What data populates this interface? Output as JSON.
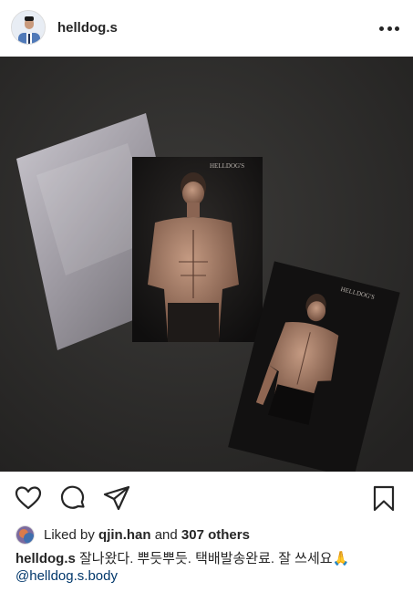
{
  "post": {
    "username": "helldog.s",
    "brand_label_1": "HELLDOG'S",
    "brand_label_2": "HELLDOG'S"
  },
  "likes": {
    "prefix": "Liked by ",
    "user": "qjin.han",
    "connector": " and ",
    "others": "307 others"
  },
  "caption": {
    "username": "helldog.s",
    "text": " 잘나왔다. 뿌듯뿌듯. 택배발송완료. 잘 쓰세요🙏",
    "mention": "@helldog.s.body",
    "truncated_line": "........ ....  ...... ..... ..... ..."
  },
  "icons": {
    "more": "more-options-icon",
    "like": "heart-icon",
    "comment": "comment-bubble-icon",
    "share": "paper-plane-icon",
    "save": "bookmark-icon"
  }
}
